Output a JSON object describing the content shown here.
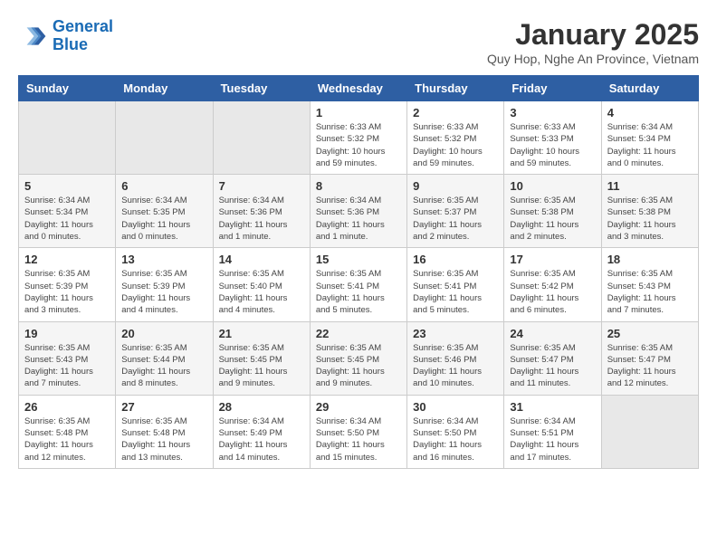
{
  "header": {
    "logo_line1": "General",
    "logo_line2": "Blue",
    "title": "January 2025",
    "subtitle": "Quy Hop, Nghe An Province, Vietnam"
  },
  "weekdays": [
    "Sunday",
    "Monday",
    "Tuesday",
    "Wednesday",
    "Thursday",
    "Friday",
    "Saturday"
  ],
  "weeks": [
    [
      {
        "day": "",
        "info": ""
      },
      {
        "day": "",
        "info": ""
      },
      {
        "day": "",
        "info": ""
      },
      {
        "day": "1",
        "info": "Sunrise: 6:33 AM\nSunset: 5:32 PM\nDaylight: 10 hours\nand 59 minutes."
      },
      {
        "day": "2",
        "info": "Sunrise: 6:33 AM\nSunset: 5:32 PM\nDaylight: 10 hours\nand 59 minutes."
      },
      {
        "day": "3",
        "info": "Sunrise: 6:33 AM\nSunset: 5:33 PM\nDaylight: 10 hours\nand 59 minutes."
      },
      {
        "day": "4",
        "info": "Sunrise: 6:34 AM\nSunset: 5:34 PM\nDaylight: 11 hours\nand 0 minutes."
      }
    ],
    [
      {
        "day": "5",
        "info": "Sunrise: 6:34 AM\nSunset: 5:34 PM\nDaylight: 11 hours\nand 0 minutes."
      },
      {
        "day": "6",
        "info": "Sunrise: 6:34 AM\nSunset: 5:35 PM\nDaylight: 11 hours\nand 0 minutes."
      },
      {
        "day": "7",
        "info": "Sunrise: 6:34 AM\nSunset: 5:36 PM\nDaylight: 11 hours\nand 1 minute."
      },
      {
        "day": "8",
        "info": "Sunrise: 6:34 AM\nSunset: 5:36 PM\nDaylight: 11 hours\nand 1 minute."
      },
      {
        "day": "9",
        "info": "Sunrise: 6:35 AM\nSunset: 5:37 PM\nDaylight: 11 hours\nand 2 minutes."
      },
      {
        "day": "10",
        "info": "Sunrise: 6:35 AM\nSunset: 5:38 PM\nDaylight: 11 hours\nand 2 minutes."
      },
      {
        "day": "11",
        "info": "Sunrise: 6:35 AM\nSunset: 5:38 PM\nDaylight: 11 hours\nand 3 minutes."
      }
    ],
    [
      {
        "day": "12",
        "info": "Sunrise: 6:35 AM\nSunset: 5:39 PM\nDaylight: 11 hours\nand 3 minutes."
      },
      {
        "day": "13",
        "info": "Sunrise: 6:35 AM\nSunset: 5:39 PM\nDaylight: 11 hours\nand 4 minutes."
      },
      {
        "day": "14",
        "info": "Sunrise: 6:35 AM\nSunset: 5:40 PM\nDaylight: 11 hours\nand 4 minutes."
      },
      {
        "day": "15",
        "info": "Sunrise: 6:35 AM\nSunset: 5:41 PM\nDaylight: 11 hours\nand 5 minutes."
      },
      {
        "day": "16",
        "info": "Sunrise: 6:35 AM\nSunset: 5:41 PM\nDaylight: 11 hours\nand 5 minutes."
      },
      {
        "day": "17",
        "info": "Sunrise: 6:35 AM\nSunset: 5:42 PM\nDaylight: 11 hours\nand 6 minutes."
      },
      {
        "day": "18",
        "info": "Sunrise: 6:35 AM\nSunset: 5:43 PM\nDaylight: 11 hours\nand 7 minutes."
      }
    ],
    [
      {
        "day": "19",
        "info": "Sunrise: 6:35 AM\nSunset: 5:43 PM\nDaylight: 11 hours\nand 7 minutes."
      },
      {
        "day": "20",
        "info": "Sunrise: 6:35 AM\nSunset: 5:44 PM\nDaylight: 11 hours\nand 8 minutes."
      },
      {
        "day": "21",
        "info": "Sunrise: 6:35 AM\nSunset: 5:45 PM\nDaylight: 11 hours\nand 9 minutes."
      },
      {
        "day": "22",
        "info": "Sunrise: 6:35 AM\nSunset: 5:45 PM\nDaylight: 11 hours\nand 9 minutes."
      },
      {
        "day": "23",
        "info": "Sunrise: 6:35 AM\nSunset: 5:46 PM\nDaylight: 11 hours\nand 10 minutes."
      },
      {
        "day": "24",
        "info": "Sunrise: 6:35 AM\nSunset: 5:47 PM\nDaylight: 11 hours\nand 11 minutes."
      },
      {
        "day": "25",
        "info": "Sunrise: 6:35 AM\nSunset: 5:47 PM\nDaylight: 11 hours\nand 12 minutes."
      }
    ],
    [
      {
        "day": "26",
        "info": "Sunrise: 6:35 AM\nSunset: 5:48 PM\nDaylight: 11 hours\nand 12 minutes."
      },
      {
        "day": "27",
        "info": "Sunrise: 6:35 AM\nSunset: 5:48 PM\nDaylight: 11 hours\nand 13 minutes."
      },
      {
        "day": "28",
        "info": "Sunrise: 6:34 AM\nSunset: 5:49 PM\nDaylight: 11 hours\nand 14 minutes."
      },
      {
        "day": "29",
        "info": "Sunrise: 6:34 AM\nSunset: 5:50 PM\nDaylight: 11 hours\nand 15 minutes."
      },
      {
        "day": "30",
        "info": "Sunrise: 6:34 AM\nSunset: 5:50 PM\nDaylight: 11 hours\nand 16 minutes."
      },
      {
        "day": "31",
        "info": "Sunrise: 6:34 AM\nSunset: 5:51 PM\nDaylight: 11 hours\nand 17 minutes."
      },
      {
        "day": "",
        "info": ""
      }
    ]
  ]
}
